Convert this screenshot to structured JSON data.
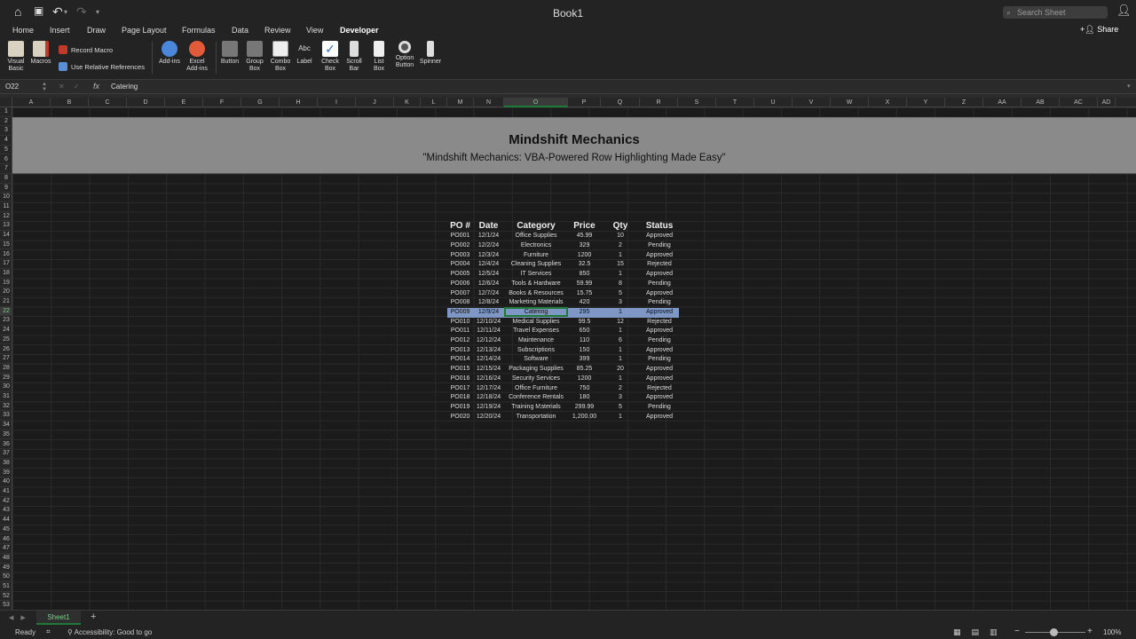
{
  "window": {
    "title": "Book1",
    "search_placeholder": "Search Sheet"
  },
  "quick_access": {
    "home_icon": "home-icon",
    "save_icon": "save-icon",
    "undo_icon": "undo-icon",
    "redo_icon": "redo-icon",
    "more_icon": "chevron-down-icon"
  },
  "tabs": [
    "Home",
    "Insert",
    "Draw",
    "Page Layout",
    "Formulas",
    "Data",
    "Review",
    "View",
    "Developer"
  ],
  "active_tab": "Developer",
  "share_label": "Share",
  "ribbon": {
    "visual_basic": "Visual Basic",
    "macros": "Macros",
    "record_macro": "Record Macro",
    "relative_refs": "Use Relative References",
    "add_ins": "Add-ins",
    "excel_add_ins": "Excel Add-ins",
    "button": "Button",
    "group_box": "Group Box",
    "combo_box": "Combo Box",
    "label": "Label",
    "label_icon_text": "Abc",
    "check_box": "Check Box",
    "scroll_bar": "Scroll Bar",
    "list_box": "List Box",
    "option_button": "Option Button",
    "spinner": "Spinner"
  },
  "formula_bar": {
    "name_box": "O22",
    "fx": "fx",
    "value": "Catering"
  },
  "columns": [
    "A",
    "B",
    "C",
    "D",
    "E",
    "F",
    "G",
    "H",
    "I",
    "J",
    "K",
    "L",
    "M",
    "N",
    "O",
    "P",
    "Q",
    "R",
    "S",
    "T",
    "U",
    "V",
    "W",
    "X",
    "Y",
    "Z",
    "AA",
    "AB",
    "AC",
    "AD"
  ],
  "selected_column": "O",
  "selected_row": "22",
  "banner": {
    "title": "Mindshift Mechanics",
    "subtitle": "\"Mindshift Mechanics: VBA-Powered Row Highlighting Made Easy\""
  },
  "table": {
    "headers": [
      "PO #",
      "Date",
      "Category",
      "Price",
      "Qty",
      "Status"
    ],
    "rows": [
      [
        "PO001",
        "12/1/24",
        "Office Supplies",
        "45.99",
        "10",
        "Approved"
      ],
      [
        "PO002",
        "12/2/24",
        "Electronics",
        "329",
        "2",
        "Pending"
      ],
      [
        "PO003",
        "12/3/24",
        "Furniture",
        "1200",
        "1",
        "Approved"
      ],
      [
        "PO004",
        "12/4/24",
        "Cleaning Supplies",
        "32.5",
        "15",
        "Rejected"
      ],
      [
        "PO005",
        "12/5/24",
        "IT Services",
        "850",
        "1",
        "Approved"
      ],
      [
        "PO006",
        "12/6/24",
        "Tools & Hardware",
        "59.99",
        "8",
        "Pending"
      ],
      [
        "PO007",
        "12/7/24",
        "Books & Resources",
        "15.75",
        "5",
        "Approved"
      ],
      [
        "PO008",
        "12/8/24",
        "Marketing Materials",
        "420",
        "3",
        "Pending"
      ],
      [
        "PO009",
        "12/9/24",
        "Catering",
        "295",
        "1",
        "Approved"
      ],
      [
        "PO010",
        "12/10/24",
        "Medical Supplies",
        "99.5",
        "12",
        "Rejected"
      ],
      [
        "PO011",
        "12/11/24",
        "Travel Expenses",
        "650",
        "1",
        "Approved"
      ],
      [
        "PO012",
        "12/12/24",
        "Maintenance",
        "110",
        "6",
        "Pending"
      ],
      [
        "PO013",
        "12/13/24",
        "Subscriptions",
        "150",
        "1",
        "Approved"
      ],
      [
        "PO014",
        "12/14/24",
        "Software",
        "399",
        "1",
        "Pending"
      ],
      [
        "PO015",
        "12/15/24",
        "Packaging Supplies",
        "85.25",
        "20",
        "Approved"
      ],
      [
        "PO016",
        "12/16/24",
        "Security Services",
        "1200",
        "1",
        "Approved"
      ],
      [
        "PO017",
        "12/17/24",
        "Office Furniture",
        "750",
        "2",
        "Rejected"
      ],
      [
        "PO018",
        "12/18/24",
        "Conference Rentals",
        "180",
        "3",
        "Approved"
      ],
      [
        "PO019",
        "12/19/24",
        "Training Materials",
        "299.99",
        "5",
        "Pending"
      ],
      [
        "PO020",
        "12/20/24",
        "Transportation",
        "1,200.00",
        "1",
        "Approved"
      ]
    ],
    "highlighted_row": "PO009",
    "highlight_color": "#7e97c4"
  },
  "sheet_tab": "Sheet1",
  "status": {
    "ready": "Ready",
    "accessibility": "Accessibility: Good to go",
    "zoom": "100%"
  },
  "colors": {
    "accent_green": "#1e7a34",
    "banner_gray": "#8a8a8a"
  }
}
